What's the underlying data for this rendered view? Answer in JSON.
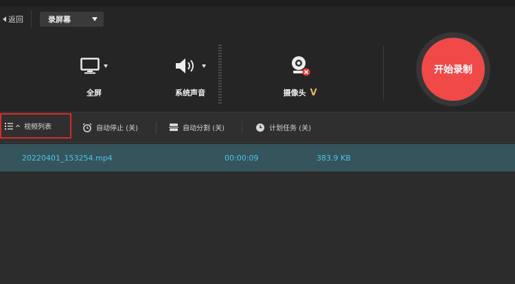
{
  "header": {
    "back_label": "返回",
    "mode_select_value": "录屏幕"
  },
  "sources": [
    {
      "label": "全屏",
      "icon": "monitor-icon"
    },
    {
      "label": "系统声音",
      "icon": "speaker-icon"
    },
    {
      "label": "摄像头",
      "icon": "webcam-icon",
      "badge": "V"
    }
  ],
  "record_button": {
    "label": "开始录制"
  },
  "toolbar": {
    "video_list_label": "视频列表",
    "auto_stop_label": "自动停止 (关)",
    "auto_split_label": "自动分割 (关)",
    "schedule_label": "计划任务 (关)"
  },
  "files": [
    {
      "name": "20220401_153254.mp4",
      "duration": "00:00:09",
      "size": "383.9 KB"
    }
  ],
  "colors": {
    "record_red": "#f14848",
    "selection_teal": "#35545c",
    "file_text": "#4cc6e6",
    "vip_gold": "#e3b56b",
    "highlight_border": "#d52b2b"
  }
}
